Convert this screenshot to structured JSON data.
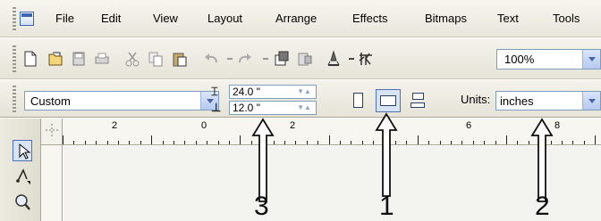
{
  "menu": {
    "items": [
      {
        "id": "file",
        "label": "File"
      },
      {
        "id": "edit",
        "label": "Edit"
      },
      {
        "id": "view",
        "label": "View"
      },
      {
        "id": "layout",
        "label": "Layout"
      },
      {
        "id": "arrange",
        "label": "Arrange"
      },
      {
        "id": "effects",
        "label": "Effects"
      },
      {
        "id": "bitmaps",
        "label": "Bitmaps"
      },
      {
        "id": "text",
        "label": "Text"
      },
      {
        "id": "tools",
        "label": "Tools"
      }
    ]
  },
  "toolbar": {
    "icons": [
      "new-document-icon",
      "open-icon",
      "save-icon",
      "print-icon",
      "cut-icon",
      "copy-icon",
      "paste-icon",
      "undo-icon",
      "redo-icon",
      "import-icon",
      "export-icon",
      "application-launcher-icon",
      "welcome-screen-icon"
    ],
    "zoom_value": "100%"
  },
  "property_bar": {
    "paper_type": "Custom",
    "width_value": "24.0 \"",
    "height_value": "12.0 \"",
    "units_label": "Units:",
    "units_value": "inches"
  },
  "ruler": {
    "labels": [
      "2",
      "0",
      "2",
      "4",
      "6",
      "8"
    ]
  },
  "callouts": [
    "3",
    "1",
    "2"
  ],
  "colors": {
    "toolbar_bg": "#eceadf",
    "field_border": "#7f9db9",
    "active_blue": "#4e6fb3"
  }
}
